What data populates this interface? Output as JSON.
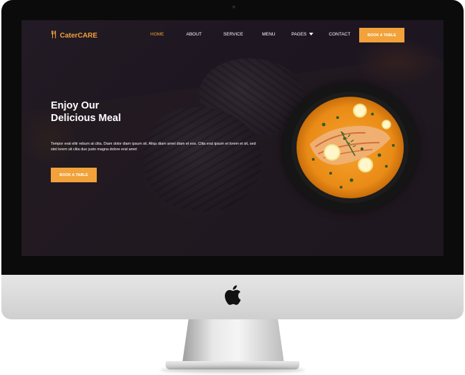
{
  "site": {
    "brand": "CaterCARE",
    "nav": [
      {
        "label": "HOME",
        "active": true
      },
      {
        "label": "ABOUT",
        "active": false
      },
      {
        "label": "SERVICE",
        "active": false
      },
      {
        "label": "MENU",
        "active": false
      },
      {
        "label": "PAGES",
        "active": false,
        "has_dropdown": true
      },
      {
        "label": "CONTACT",
        "active": false
      }
    ],
    "nav_cta": "BOOK A TABLE",
    "hero": {
      "title_line1": "Enjoy Our",
      "title_line2": "Delicious Meal",
      "text": "Tempor erat elitr rebum at clita. Diam dolor diam ipsum sit. Aliqu diam amet diam et eos. Clita erat ipsum et lorem et sit, sed stet lorem sit clita duo justo magna dolore erat amet",
      "cta": "BOOK A TABLE"
    }
  },
  "icons": {
    "brand": "fork-knife-icon",
    "dropdown": "caret-down-icon",
    "device_logo": "apple-logo-icon"
  },
  "colors": {
    "accent": "#f2a23a",
    "screen_bg": "#231c24",
    "text": "#ffffff",
    "bezel": "#0b0b0b",
    "chin": "#dcdcdc"
  }
}
